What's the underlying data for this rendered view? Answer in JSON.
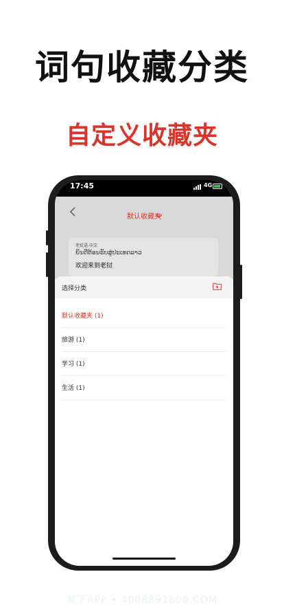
{
  "headline": "词句收藏分类",
  "subhead": "自定义收藏夹",
  "status_bar": {
    "time": "17:45",
    "network": "4G"
  },
  "app_bar": {
    "title": "默认收藏夹",
    "back_icon": "chevron-left-icon",
    "dropdown_icon": "chevron-down-icon"
  },
  "entry_card": {
    "language_pair": "老挝语-中文",
    "source_text": "ຍິນດີຕ້ອນຮັບສູ່ປະເທດລາວ",
    "translation": "欢迎来到老挝"
  },
  "category_sheet": {
    "title": "选择分类",
    "add_folder_icon": "folder-add-icon",
    "items": [
      {
        "label": "默认收藏夹 (1)",
        "selected": true
      },
      {
        "label": "旅游 (1)",
        "selected": false
      },
      {
        "label": "学习 (1)",
        "selected": false
      },
      {
        "label": "生活 (1)",
        "selected": false
      }
    ]
  },
  "watermark": "易下APP • 4008891800.COM",
  "colors": {
    "accent": "#d8362c",
    "overlay": "#d9d9d9",
    "card": "#e4e4e4"
  }
}
